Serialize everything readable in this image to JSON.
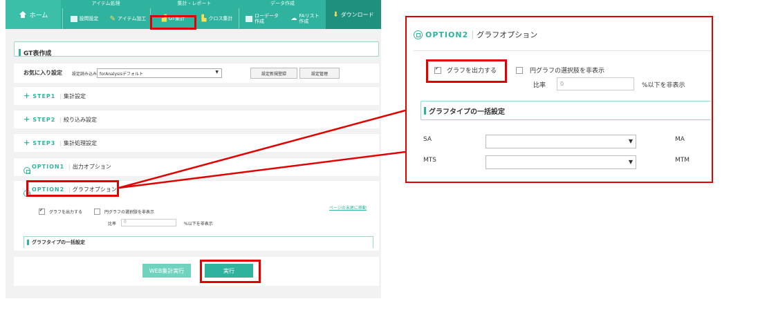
{
  "top_nav": {
    "home": "ホーム",
    "groups": [
      "アイテム処理",
      "集計・レポート",
      "データ作成"
    ],
    "items": [
      {
        "label": "設問設定"
      },
      {
        "label": "アイテム加工"
      },
      {
        "label": "GT集計"
      },
      {
        "label": "クロス集計"
      },
      {
        "label": "ローデータ\n作成"
      },
      {
        "label": "FAリスト\n作成"
      }
    ],
    "download": "ダウンロード"
  },
  "page_title": "GT表作成",
  "favorites": {
    "label": "お気に入り設定",
    "load_label": "設定読み込み",
    "selected": "forAnalysisデフォルト",
    "register_button": "設定新規登録",
    "manage_button": "設定管理"
  },
  "steps": [
    {
      "tag": "STEP1",
      "label": "集計設定"
    },
    {
      "tag": "STEP2",
      "label": "絞り込み設定"
    },
    {
      "tag": "STEP3",
      "label": "集計処理設定"
    }
  ],
  "option1": {
    "tag": "OPTION1",
    "label": "出力オプション"
  },
  "option2": {
    "tag": "OPTION2",
    "label": "グラフオプション",
    "output_graph": "グラフを出力する",
    "hide_pie": "円グラフの選択肢を非表示",
    "ratio_label": "比率",
    "ratio_value": "0",
    "ratio_suffix": "%以下を非表示",
    "page_end_link": "ページの末尾に移動",
    "bulk_section": "グラフタイプの一括設定"
  },
  "actions": {
    "web_run": "WEB集計実行",
    "run": "実行"
  },
  "zoom": {
    "sa": "SA",
    "ma": "MA",
    "mts": "MTS",
    "mtm": "MTM"
  },
  "colors": {
    "accent": "#2fb39e",
    "highlight": "#e00000"
  }
}
